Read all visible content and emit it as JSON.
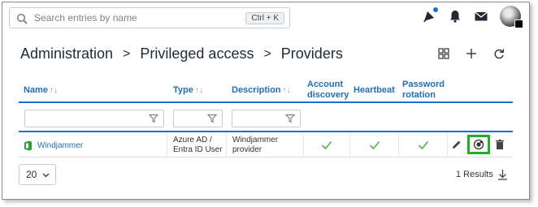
{
  "search": {
    "placeholder": "Search entries by name",
    "shortcut": "Ctrl + K"
  },
  "topbar": {
    "icons": [
      "announcement-icon",
      "bell-icon",
      "mail-icon",
      "user-avatar"
    ]
  },
  "breadcrumb": {
    "items": [
      "Administration",
      "Privileged access",
      "Providers"
    ],
    "separator": ">"
  },
  "page_actions": [
    "grid-view-icon",
    "add-icon",
    "refresh-icon"
  ],
  "table": {
    "columns": {
      "name": "Name",
      "type": "Type",
      "description": "Description",
      "account_discovery": "Account discovery",
      "heartbeat": "Heartbeat",
      "password_rotation": "Password rotation"
    },
    "sort_glyph": "↑↓",
    "rows": [
      {
        "name": "Windjammer",
        "type_line1": "Azure AD /",
        "type_line2": "Entra ID User",
        "description_line1": "Windjammer",
        "description_line2": "provider",
        "account_discovery": true,
        "heartbeat": true,
        "password_rotation": true
      }
    ]
  },
  "footer": {
    "page_size": "20",
    "results": "1 Results"
  },
  "colors": {
    "accent": "#1c6ed6",
    "check": "#58b24d",
    "highlight": "#22b022"
  }
}
